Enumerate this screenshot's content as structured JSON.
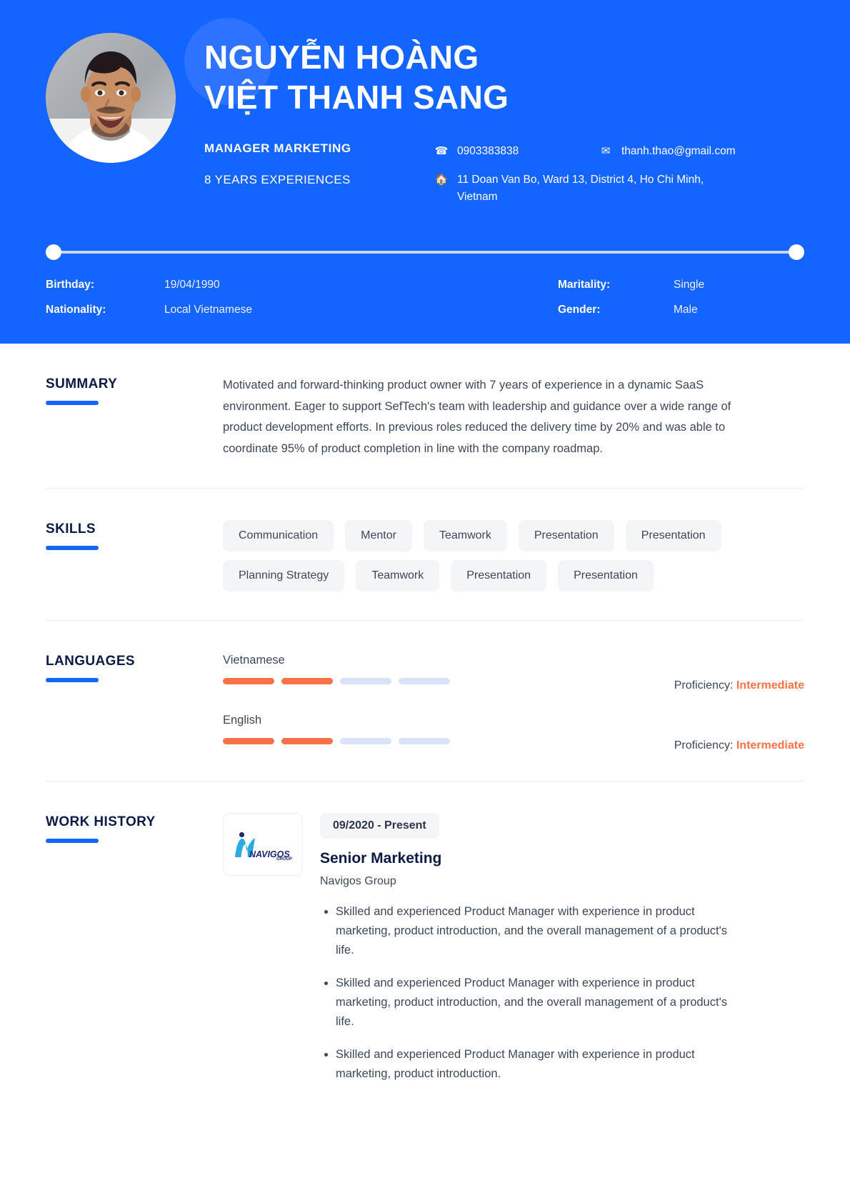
{
  "theme": {
    "brand_blue": "#1464FF",
    "accent_orange": "#F97146",
    "navy": "#0B1B46",
    "tag_bg": "#F4F5F7",
    "bar_empty": "#D8E2FB"
  },
  "header": {
    "name_line1": "NGUYỄN HOÀNG",
    "name_line2": "VIỆT THANH SANG",
    "role": "MANAGER MARKETING",
    "years": "8 YEARS EXPERIENCES",
    "phone_icon": "phone-icon",
    "phone": "0903383838",
    "email_icon": "envelope-icon",
    "email": "thanh.thao@gmail.com",
    "address_icon": "home-icon",
    "address": "11 Doan Van Bo, Ward 13, District 4,  Ho Chi Minh, Vietnam",
    "details_left": [
      {
        "label": "Birthday:",
        "value": "19/04/1990"
      },
      {
        "label": "Nationality:",
        "value": "Local Vietnamese"
      }
    ],
    "details_right": [
      {
        "label": "Maritality:",
        "value": "Single"
      },
      {
        "label": "Gender:",
        "value": "Male"
      }
    ]
  },
  "summary": {
    "title": "SUMMARY",
    "text": "Motivated and forward-thinking product owner with 7 years of experience in a dynamic SaaS environment. Eager to support SefTech's team with leadership and guidance over a wide range of product development efforts. In previous roles reduced the delivery time by 20% and was able to coordinate 95% of product completion in line with the company roadmap."
  },
  "skills": {
    "title": "SKILLS",
    "items": [
      "Communication",
      "Mentor",
      "Teamwork",
      "Presentation",
      "Presentation",
      "Planning Strategy",
      "Teamwork",
      "Presentation",
      "Presentation"
    ]
  },
  "languages": {
    "title": "LANGUAGES",
    "proficiency_label": "Proficiency:",
    "items": [
      {
        "name": "Vietnamese",
        "level": 2,
        "total": 4,
        "proficiency": "Intermediate"
      },
      {
        "name": "English",
        "level": 2,
        "total": 4,
        "proficiency": "Intermediate"
      }
    ]
  },
  "work_history": {
    "title": "WORK HISTORY",
    "jobs": [
      {
        "logo_name": "navigos-group-logo",
        "logo_text": "NAVIGOS",
        "logo_subtext": "GROUP",
        "period": "09/2020 - Present",
        "title": "Senior Marketing",
        "company": "Navigos Group",
        "bullets": [
          "Skilled and experienced Product Manager with experience in product marketing, product introduction, and the overall management of a product's life.",
          "Skilled and experienced Product Manager with experience in product marketing, product introduction, and the overall management of a product's life.",
          "Skilled and experienced Product Manager with experience in product marketing, product introduction."
        ]
      }
    ]
  }
}
